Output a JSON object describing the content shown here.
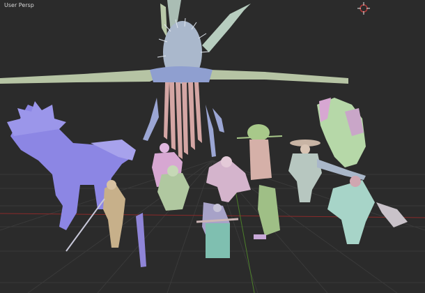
{
  "viewport": {
    "view_label": "User Persp",
    "background_color": "#2b2b2b",
    "grid_color": "#3b3b3b",
    "axis_x_color": "#8a2a2a",
    "axis_y_color": "#4c7f2a"
  },
  "scene": {
    "description_icon": "3d-character-models",
    "models": [
      {
        "name": "giant-spiky-creature",
        "color": "#9db9c8"
      },
      {
        "name": "spiky-horse",
        "color": "#8a7fe0"
      },
      {
        "name": "pink-cloaked-figure",
        "color": "#d7a7d2"
      },
      {
        "name": "green-bushy-figure",
        "color": "#a8c98a"
      },
      {
        "name": "wide-hat-figure",
        "color": "#b7c7c0"
      },
      {
        "name": "leafy-creature",
        "color": "#b6d8a8"
      }
    ]
  },
  "gizmo": {
    "icon": "crosshair-icon",
    "color": "#b33a3a"
  }
}
